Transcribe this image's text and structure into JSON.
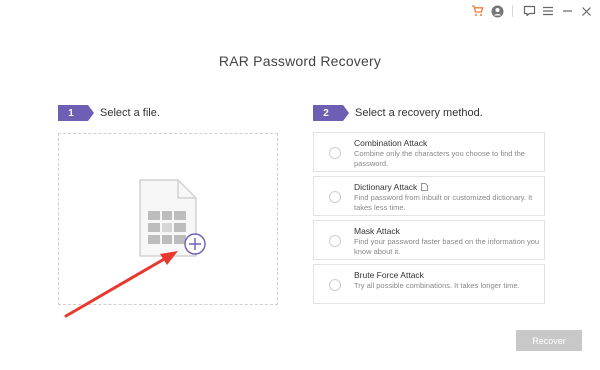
{
  "titlebar": {
    "icons": [
      "cart-icon",
      "account-icon",
      "feedback-icon",
      "menu-icon",
      "minimize-icon",
      "close-icon"
    ],
    "accent_color": "#f07c38"
  },
  "app": {
    "title": "RAR Password Recovery"
  },
  "steps": [
    {
      "number": "1",
      "label": "Select a file."
    },
    {
      "number": "2",
      "label": "Select a recovery method."
    }
  ],
  "dropzone": {
    "icon": "rar-file-add-icon"
  },
  "methods": [
    {
      "title": "Combination Attack",
      "desc": "Combine only the characters you choose to find the password.",
      "selected": false
    },
    {
      "title": "Dictionary Attack",
      "desc": "Find password from inbuilt or customized dictionary. It takes less time.",
      "selected": false,
      "icon": "document-icon"
    },
    {
      "title": "Mask Attack",
      "desc": "Find your password faster based on the information you know about it.",
      "selected": false
    },
    {
      "title": "Brute Force Attack",
      "desc": "Try all possible combinations. It takes longer time.",
      "selected": false
    }
  ],
  "recover_button": {
    "label": "Recover",
    "enabled": false
  },
  "colors": {
    "step_badge": "#6e5eb4",
    "annotation_arrow": "#e8392f"
  }
}
